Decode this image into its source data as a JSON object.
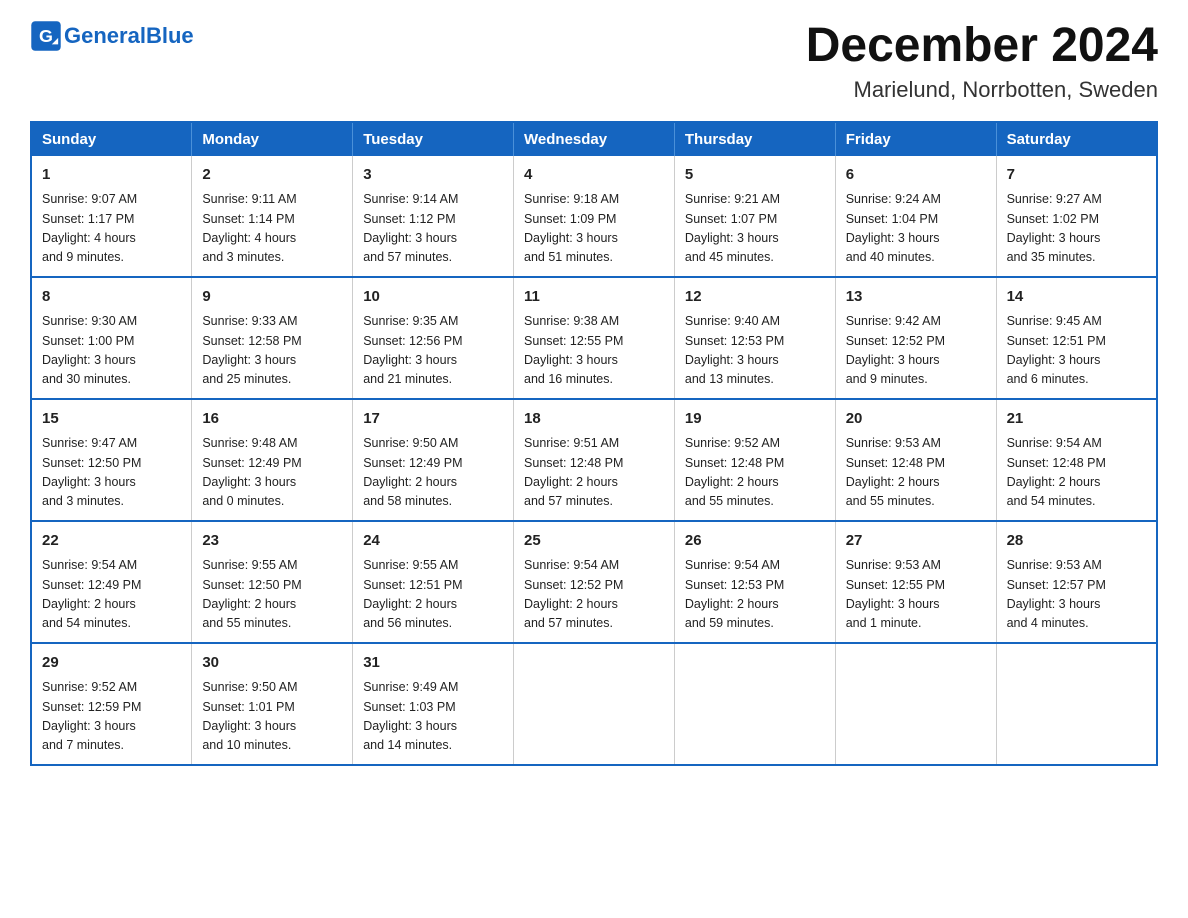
{
  "header": {
    "logo_general": "General",
    "logo_blue": "Blue",
    "title": "December 2024",
    "subtitle": "Marielund, Norrbotten, Sweden"
  },
  "days_of_week": [
    "Sunday",
    "Monday",
    "Tuesday",
    "Wednesday",
    "Thursday",
    "Friday",
    "Saturday"
  ],
  "weeks": [
    [
      {
        "day": "1",
        "info": "Sunrise: 9:07 AM\nSunset: 1:17 PM\nDaylight: 4 hours\nand 9 minutes."
      },
      {
        "day": "2",
        "info": "Sunrise: 9:11 AM\nSunset: 1:14 PM\nDaylight: 4 hours\nand 3 minutes."
      },
      {
        "day": "3",
        "info": "Sunrise: 9:14 AM\nSunset: 1:12 PM\nDaylight: 3 hours\nand 57 minutes."
      },
      {
        "day": "4",
        "info": "Sunrise: 9:18 AM\nSunset: 1:09 PM\nDaylight: 3 hours\nand 51 minutes."
      },
      {
        "day": "5",
        "info": "Sunrise: 9:21 AM\nSunset: 1:07 PM\nDaylight: 3 hours\nand 45 minutes."
      },
      {
        "day": "6",
        "info": "Sunrise: 9:24 AM\nSunset: 1:04 PM\nDaylight: 3 hours\nand 40 minutes."
      },
      {
        "day": "7",
        "info": "Sunrise: 9:27 AM\nSunset: 1:02 PM\nDaylight: 3 hours\nand 35 minutes."
      }
    ],
    [
      {
        "day": "8",
        "info": "Sunrise: 9:30 AM\nSunset: 1:00 PM\nDaylight: 3 hours\nand 30 minutes."
      },
      {
        "day": "9",
        "info": "Sunrise: 9:33 AM\nSunset: 12:58 PM\nDaylight: 3 hours\nand 25 minutes."
      },
      {
        "day": "10",
        "info": "Sunrise: 9:35 AM\nSunset: 12:56 PM\nDaylight: 3 hours\nand 21 minutes."
      },
      {
        "day": "11",
        "info": "Sunrise: 9:38 AM\nSunset: 12:55 PM\nDaylight: 3 hours\nand 16 minutes."
      },
      {
        "day": "12",
        "info": "Sunrise: 9:40 AM\nSunset: 12:53 PM\nDaylight: 3 hours\nand 13 minutes."
      },
      {
        "day": "13",
        "info": "Sunrise: 9:42 AM\nSunset: 12:52 PM\nDaylight: 3 hours\nand 9 minutes."
      },
      {
        "day": "14",
        "info": "Sunrise: 9:45 AM\nSunset: 12:51 PM\nDaylight: 3 hours\nand 6 minutes."
      }
    ],
    [
      {
        "day": "15",
        "info": "Sunrise: 9:47 AM\nSunset: 12:50 PM\nDaylight: 3 hours\nand 3 minutes."
      },
      {
        "day": "16",
        "info": "Sunrise: 9:48 AM\nSunset: 12:49 PM\nDaylight: 3 hours\nand 0 minutes."
      },
      {
        "day": "17",
        "info": "Sunrise: 9:50 AM\nSunset: 12:49 PM\nDaylight: 2 hours\nand 58 minutes."
      },
      {
        "day": "18",
        "info": "Sunrise: 9:51 AM\nSunset: 12:48 PM\nDaylight: 2 hours\nand 57 minutes."
      },
      {
        "day": "19",
        "info": "Sunrise: 9:52 AM\nSunset: 12:48 PM\nDaylight: 2 hours\nand 55 minutes."
      },
      {
        "day": "20",
        "info": "Sunrise: 9:53 AM\nSunset: 12:48 PM\nDaylight: 2 hours\nand 55 minutes."
      },
      {
        "day": "21",
        "info": "Sunrise: 9:54 AM\nSunset: 12:48 PM\nDaylight: 2 hours\nand 54 minutes."
      }
    ],
    [
      {
        "day": "22",
        "info": "Sunrise: 9:54 AM\nSunset: 12:49 PM\nDaylight: 2 hours\nand 54 minutes."
      },
      {
        "day": "23",
        "info": "Sunrise: 9:55 AM\nSunset: 12:50 PM\nDaylight: 2 hours\nand 55 minutes."
      },
      {
        "day": "24",
        "info": "Sunrise: 9:55 AM\nSunset: 12:51 PM\nDaylight: 2 hours\nand 56 minutes."
      },
      {
        "day": "25",
        "info": "Sunrise: 9:54 AM\nSunset: 12:52 PM\nDaylight: 2 hours\nand 57 minutes."
      },
      {
        "day": "26",
        "info": "Sunrise: 9:54 AM\nSunset: 12:53 PM\nDaylight: 2 hours\nand 59 minutes."
      },
      {
        "day": "27",
        "info": "Sunrise: 9:53 AM\nSunset: 12:55 PM\nDaylight: 3 hours\nand 1 minute."
      },
      {
        "day": "28",
        "info": "Sunrise: 9:53 AM\nSunset: 12:57 PM\nDaylight: 3 hours\nand 4 minutes."
      }
    ],
    [
      {
        "day": "29",
        "info": "Sunrise: 9:52 AM\nSunset: 12:59 PM\nDaylight: 3 hours\nand 7 minutes."
      },
      {
        "day": "30",
        "info": "Sunrise: 9:50 AM\nSunset: 1:01 PM\nDaylight: 3 hours\nand 10 minutes."
      },
      {
        "day": "31",
        "info": "Sunrise: 9:49 AM\nSunset: 1:03 PM\nDaylight: 3 hours\nand 14 minutes."
      },
      {
        "day": "",
        "info": ""
      },
      {
        "day": "",
        "info": ""
      },
      {
        "day": "",
        "info": ""
      },
      {
        "day": "",
        "info": ""
      }
    ]
  ]
}
